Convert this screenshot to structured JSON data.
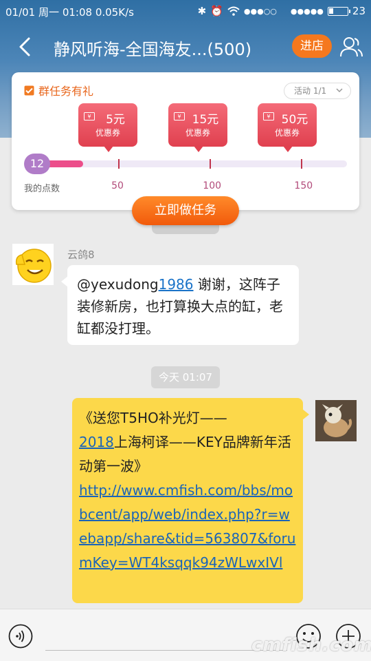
{
  "status_bar": {
    "date": "01/01",
    "weekday": "周一",
    "time": "01:08",
    "speed": "0.05K/s",
    "signal": "●●●○○",
    "signal2": "●●●●●",
    "battery_level": 23,
    "battery_text": "23"
  },
  "nav": {
    "title": "静风听海-全国海友...(500)",
    "store_button": "进店"
  },
  "task_card": {
    "title": "群任务有礼",
    "activity_tag": "活动 1/1",
    "coupons": [
      {
        "amount": "5元",
        "label": "优惠券"
      },
      {
        "amount": "15元",
        "label": "优惠券"
      },
      {
        "amount": "50元",
        "label": "优惠券"
      }
    ],
    "my_points": "12",
    "points_value": 12,
    "points_label": "我的点数",
    "milestones": [
      "50",
      "100",
      "150"
    ],
    "milestone_values": [
      50,
      100,
      150
    ],
    "do_task_button": "立即做任务"
  },
  "messages": [
    {
      "sender": "云鸽8",
      "prefix": "@yexudong",
      "link": "1986",
      "text": " 谢谢，这阵子装修新房，也打算换大点的缸，老缸都没打理。"
    },
    {
      "time": "今天  01:07",
      "line_a": "《送您T5HO补光灯——",
      "year_link": "2018",
      "line_b": "上海柯译——KEY品牌新年活动第一波》",
      "url": "http://www.cmfish.com/bbs/mobcent/app/web/index.php?r=webapp/share&tid=563807&forumKey=WT4ksqqk94zWLwxIVl"
    }
  ],
  "watermark": "cmfish.com",
  "colors": {
    "accent_orange": "#f15a0b",
    "coupon_red": "#e0404f",
    "self_bubble": "#fcd84a",
    "link_blue": "#1a73c8"
  }
}
